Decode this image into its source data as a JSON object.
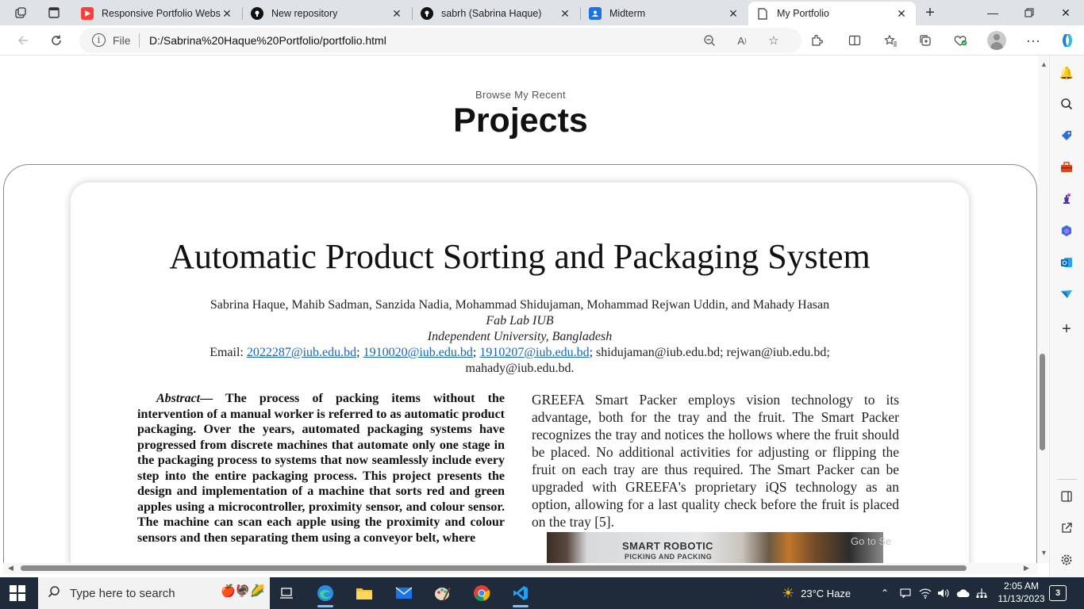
{
  "browser": {
    "tabs": [
      {
        "title": "Responsive Portfolio Websit",
        "icon": "youtube-icon"
      },
      {
        "title": "New repository",
        "icon": "github-icon"
      },
      {
        "title": "sabrh (Sabrina Haque)",
        "icon": "github-icon"
      },
      {
        "title": "Midterm",
        "icon": "classroom-icon"
      },
      {
        "title": "My Portfolio",
        "icon": "page-icon"
      }
    ],
    "address": {
      "scheme_label": "File",
      "url": "D:/Sabrina%20Haque%20Portfolio/portfolio.html"
    }
  },
  "page": {
    "subtitle": "Browse My Recent",
    "heading": "Projects"
  },
  "paper": {
    "title": "Automatic Product Sorting and Packaging System",
    "authors": "Sabrina Haque, Mahib Sadman, Sanzida Nadia, Mohammad Shidujaman, Mohammad Rejwan Uddin, and Mahady Hasan",
    "affiliation_1": "Fab Lab IUB",
    "affiliation_2": "Independent University, Bangladesh",
    "email_label": "Email:",
    "email_link_1": "2022287@iub.edu.bd",
    "email_link_2": "1910020@iub.edu.bd",
    "email_link_3": "1910207@iub.edu.bd",
    "email_rest": "; shidujaman@iub.edu.bd; rejwan@iub.edu.bd;",
    "email_last": "mahady@iub.edu.bd.",
    "abstract_label": "Abstract",
    "abstract_text": "— The process of packing items without the intervention of a manual worker is referred to as automatic product packaging. Over the years, automated packaging systems have progressed from discrete machines that automate only one stage in the packaging process to systems that now seamlessly include every step into the entire packaging process. This project presents the design and implementation of a machine that sorts red and green apples using a microcontroller, proximity sensor, and colour sensor. The machine can scan each apple using the proximity and colour sensors and then separating them using a conveyor belt, where",
    "right_text": "GREEFA Smart Packer employs vision technology to its advantage, both for the tray and the fruit. The Smart Packer recognizes the tray and notices the hollows where the fruit should be placed. No additional activities for adjusting or flipping the fruit on each tray are thus required. The Smart Packer can be upgraded with GREEFA's proprietary iQS technology as an option, allowing for a last quality check before the fruit is placed on the tray [5].",
    "photo_text_1": "SMART ROBOTIC",
    "photo_text_2": "PICKING AND PACKING",
    "watermark": "Go to Se"
  },
  "taskbar": {
    "search_placeholder": "Type here to search",
    "weather": "23°C  Haze",
    "time": "2:05 AM",
    "date": "11/13/2023",
    "notifications": "3"
  },
  "colors": {
    "link": "#1565c0",
    "taskbar": "#1f2b3b",
    "tabbar": "#dfe3e8"
  }
}
